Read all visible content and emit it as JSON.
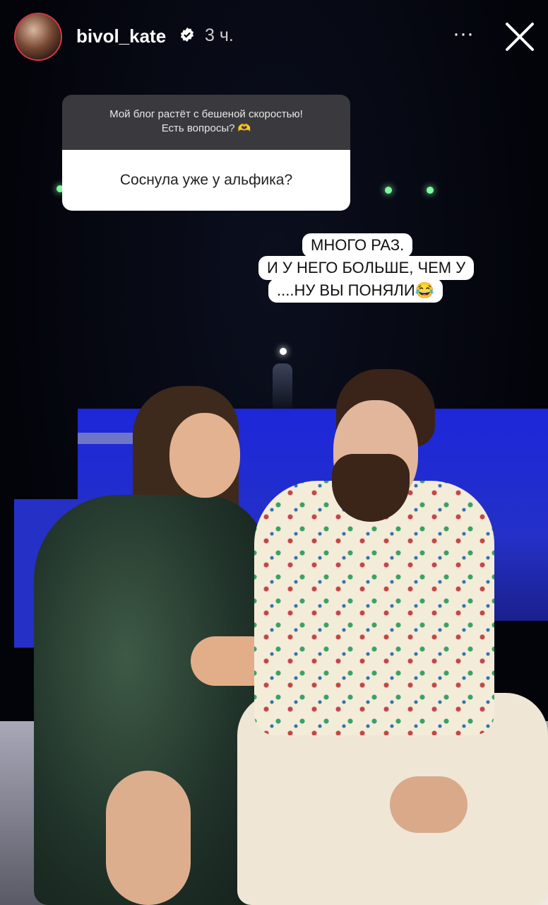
{
  "header": {
    "username": "bivol_kate",
    "time": "3 ч.",
    "more_label": "···"
  },
  "question_sticker": {
    "prompt_line1": "Мой блог растёт с бешеной скоростью!",
    "prompt_line2": "Есть вопросы? 🫶",
    "question": "Соснула уже у альфика?"
  },
  "answer": {
    "line1": "МНОГО РАЗ.",
    "line2": "И У НЕГО БОЛЬШЕ, ЧЕМ У",
    "line3": "....НУ ВЫ ПОНЯЛИ😂"
  },
  "colors": {
    "verified": "#ffffff",
    "pool": "#2430c8",
    "avatar_ring": "#e0364a"
  }
}
